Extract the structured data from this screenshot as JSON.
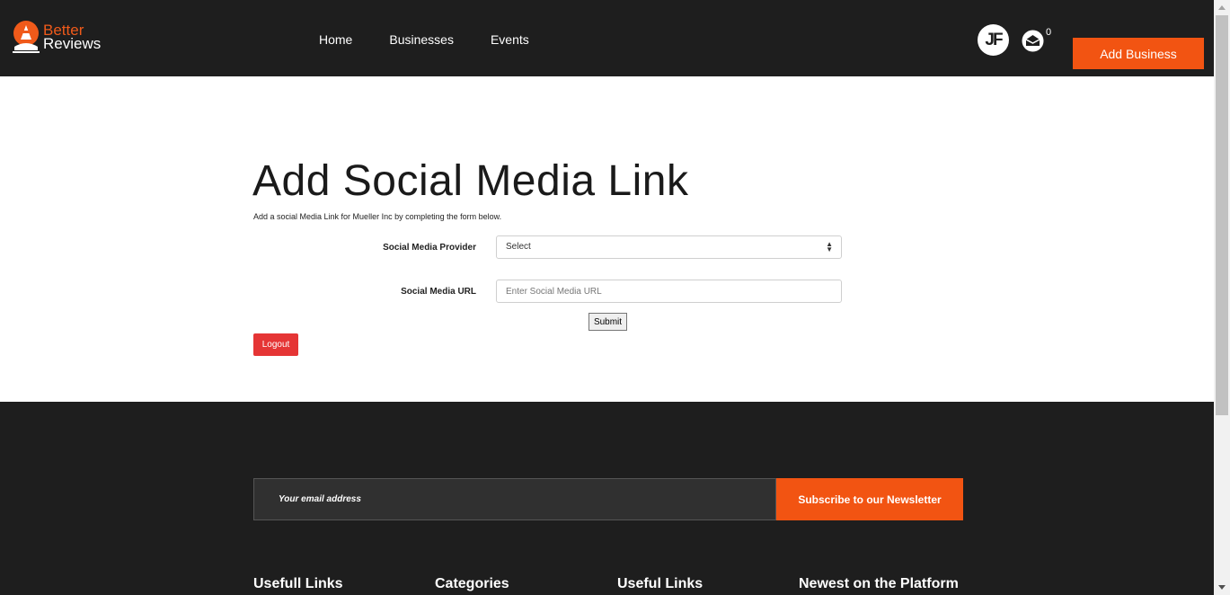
{
  "header": {
    "brand_line1": "Better",
    "brand_line2": "Reviews",
    "nav": [
      "Home",
      "Businesses",
      "Events"
    ],
    "avatar_initials": "JF",
    "mail_count": "0",
    "add_business_label": "Add Business"
  },
  "main": {
    "title": "Add Social Media Link",
    "subtitle": "Add a social Media Link for Mueller Inc by completing the form below.",
    "provider_label": "Social Media Provider",
    "provider_selected": "Select",
    "url_label": "Social Media URL",
    "url_placeholder": "Enter Social Media URL",
    "submit_label": "Submit",
    "logout_label": "Logout"
  },
  "footer": {
    "newsletter_placeholder": "Your email address",
    "newsletter_button": "Subscribe to our Newsletter",
    "columns": [
      "Usefull Links",
      "Categories",
      "Useful Links",
      "Newest on the Platform"
    ]
  },
  "colors": {
    "accent": "#f25412",
    "dark": "#1e1e1e",
    "logout": "#e53535"
  }
}
